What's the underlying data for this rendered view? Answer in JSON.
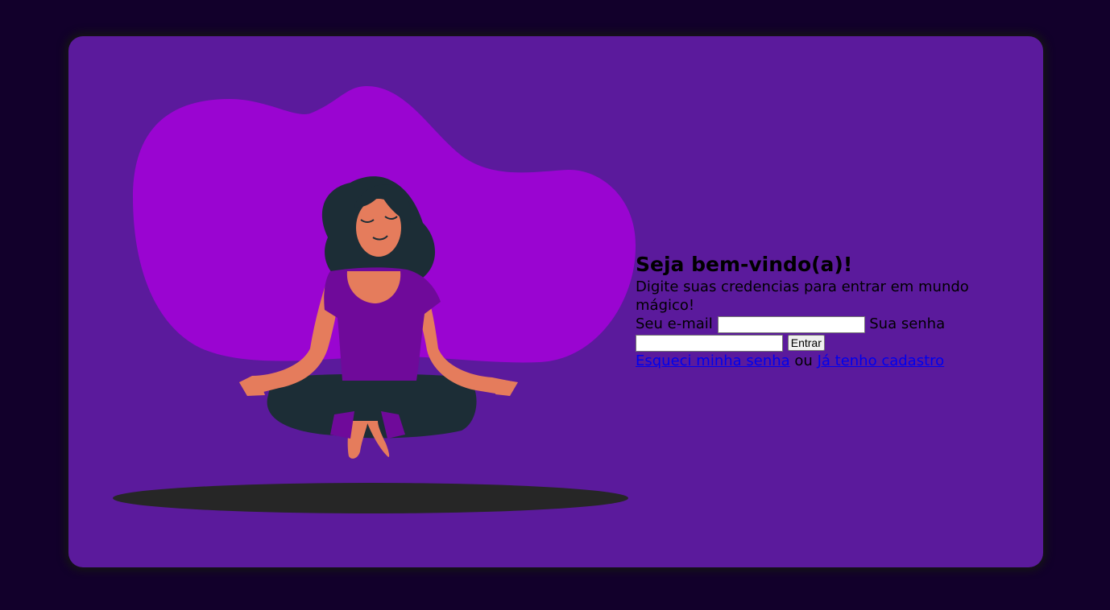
{
  "card": {
    "heading": "Seja bem-vindo(a)!",
    "subtitle": "Digite suas credencias para entrar em mundo mágico!"
  },
  "form": {
    "email_label": "Seu e-mail",
    "email_value": "",
    "password_label": "Sua senha",
    "password_value": "",
    "submit_label": "Entrar"
  },
  "links": {
    "forgot_password": "Esqueci minha senha",
    "separator": "ou",
    "already_registered": "Já tenho cadastro"
  },
  "colors": {
    "page_background": "#12002b",
    "card_background": "#5b1a9c",
    "blob": "#9a05d1",
    "shadow": "#262626",
    "hair_and_pants": "#1c2d36",
    "skin": "#e57c5c",
    "shirt": "#6f0a9a",
    "link": "#0000ee"
  },
  "illustration": {
    "subject": "meditating-woman-illustration"
  }
}
